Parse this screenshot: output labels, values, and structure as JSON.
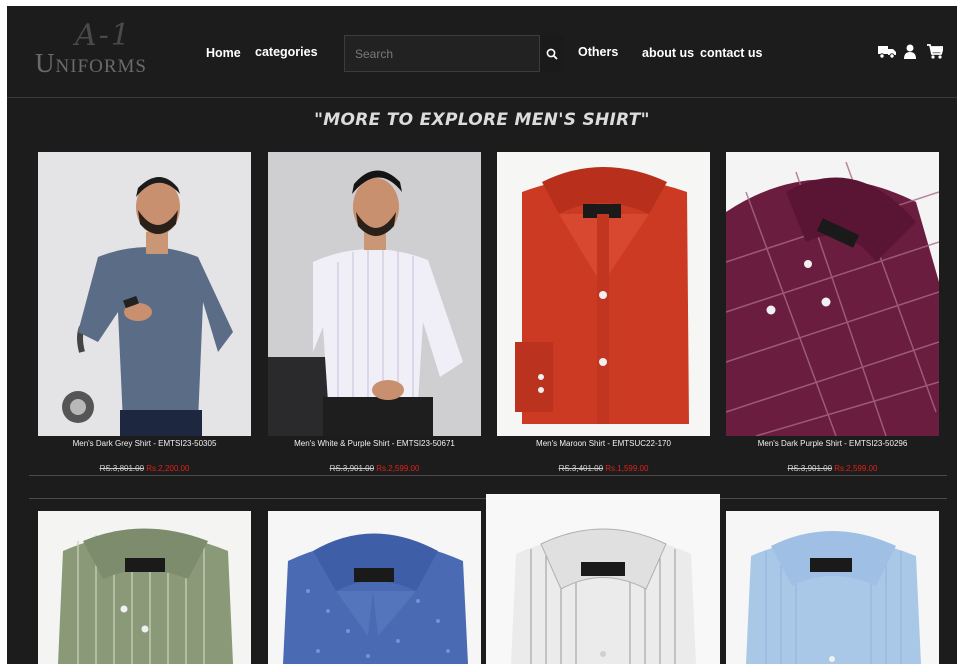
{
  "header": {
    "logo_script": "A-1",
    "logo_word": "Uniforms",
    "nav": {
      "home": "Home",
      "categories": "categories",
      "others": "Others",
      "about": "about us",
      "contact": "contact us"
    },
    "search_placeholder": "Search"
  },
  "banner": "\"MORE TO EXPLORE MEN'S SHIRT\"",
  "products_row1": [
    {
      "name": "Men's Dark Grey Shirt - EMTSI23-50305",
      "old_price": "RS.3,801.00",
      "new_price": "Rs.2,200.00"
    },
    {
      "name": "Men's White & Purple Shirt - EMTSI23-50671",
      "old_price": "RS.3,901.00",
      "new_price": "Rs.2,599.00"
    },
    {
      "name": "Men's Maroon Shirt - EMTSUC22-170",
      "old_price": "RS.3,401.00",
      "new_price": "Rs.1,599.00"
    },
    {
      "name": "Men's Dark Purple Shirt - EMTSI23-50296",
      "old_price": "RS.3,901.00",
      "new_price": "Rs.2,599.00"
    }
  ],
  "colors": {
    "background": "#1c1c1c",
    "sale_price": "#e0211b",
    "text": "#ffffff"
  },
  "icons": [
    "search-icon",
    "delivery-truck-icon",
    "user-icon",
    "cart-icon"
  ]
}
